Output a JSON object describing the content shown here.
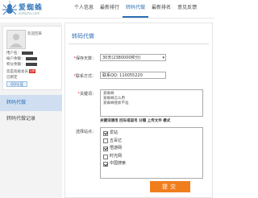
{
  "header": {
    "logo_text": "爱蜘蛛",
    "logo_sub": "aizhizhu.com",
    "nav": [
      "个人信息",
      "最新排行",
      "转码代做",
      "最新排名",
      "意见反馈"
    ],
    "nav_active_index": 2
  },
  "sidebar": {
    "welcome": "欢迎回来",
    "lines": [
      "用户名：",
      "帐户余额：",
      "积分余额：",
      "您是高级会员",
      "已绑定"
    ],
    "vip_label": "VIP",
    "qq_label": "QQ认证",
    "items": [
      {
        "label": "转码代做",
        "active": true
      },
      {
        "label": "转码代做记录",
        "active": false
      }
    ]
  },
  "form": {
    "title": "转码代做",
    "period_label": "保存天数",
    "period_value": "30天(2380000积分)",
    "contact_label": "联系方式",
    "contact_value": "联系QQ: 110055220",
    "keywords_label": "关键词",
    "keywords": [
      "爱蜘蛛",
      "爱蜘蛛怎么用",
      "爱蜘蛛搜索不准"
    ],
    "keywords_hint": "关键词请用 回车或逗号 分隔 上传文件 模式",
    "sites_label": "选择站点",
    "sites": [
      {
        "label": "爱站",
        "checked": true
      },
      {
        "label": "五百亿",
        "checked": false
      },
      {
        "label": "悟游网",
        "checked": true
      },
      {
        "label": "时光网",
        "checked": false
      },
      {
        "label": "中国搜索",
        "checked": true
      }
    ],
    "submit_label": "提交"
  },
  "colors": {
    "accent": "#2d6db4",
    "submit": "#f07e1d",
    "vip": "#d9241c",
    "sidebar_active": "#cfdff1"
  },
  "icons": [
    "spider-logo-icon",
    "avatar-placeholder",
    "checkbox-icon",
    "dropdown-caret-icon"
  ]
}
